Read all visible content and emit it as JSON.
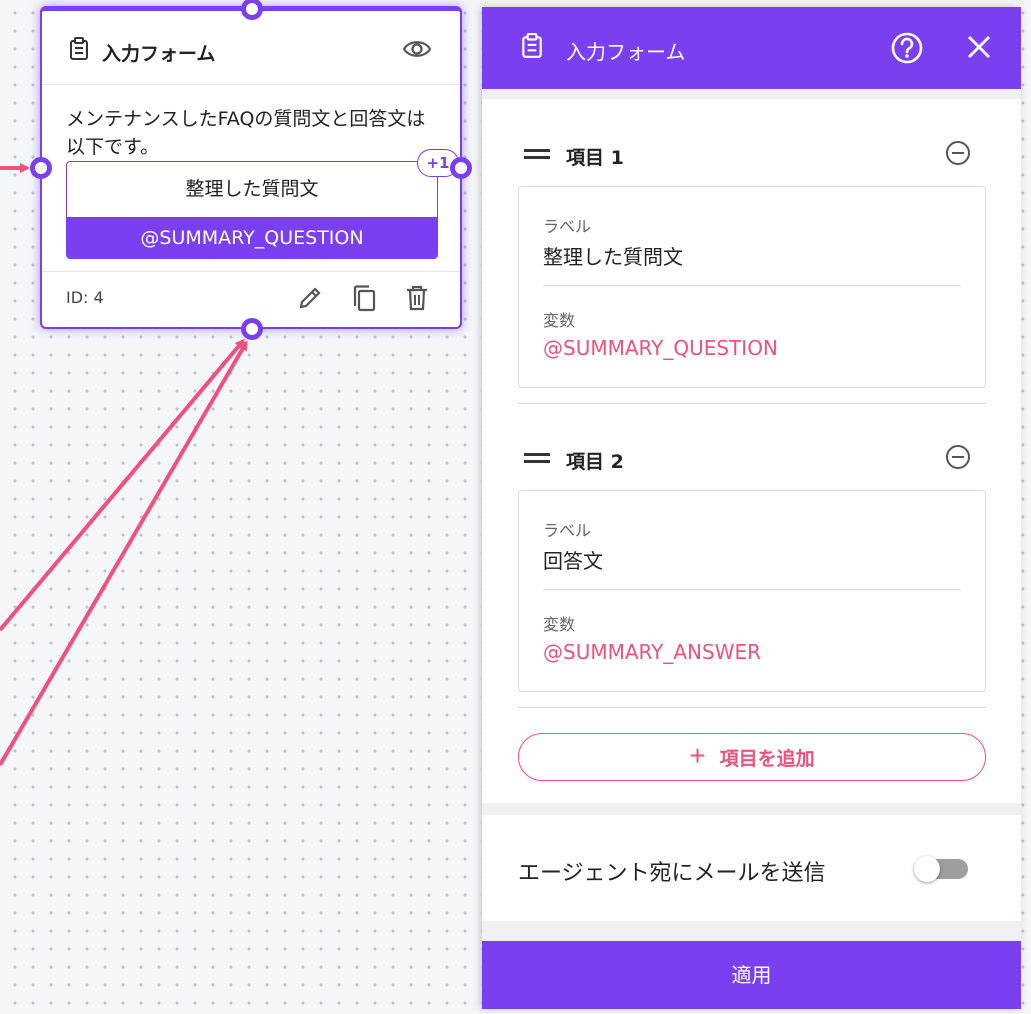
{
  "node": {
    "title": "入力フォーム",
    "description": "メンテナンスしたFAQの質問文と回答文は以下です。",
    "item_label": "整理した質問文",
    "item_variable": "@SUMMARY_QUESTION",
    "extra_count_badge": "+1",
    "id_label": "ID: 4",
    "icons": {
      "header": "clipboard-icon",
      "preview": "eye-icon",
      "edit": "pencil-icon",
      "copy": "copy-icon",
      "delete": "trash-icon"
    }
  },
  "panel": {
    "title": "入力フォーム",
    "icons": {
      "header": "clipboard-icon",
      "help": "help-circle-icon",
      "close": "close-icon"
    },
    "items": [
      {
        "title": "項目 1",
        "label_caption": "ラベル",
        "label_value": "整理した質問文",
        "variable_caption": "変数",
        "variable_value": "@SUMMARY_QUESTION"
      },
      {
        "title": "項目 2",
        "label_caption": "ラベル",
        "label_value": "回答文",
        "variable_caption": "変数",
        "variable_value": "@SUMMARY_ANSWER"
      }
    ],
    "add_item_icon": "+",
    "add_item_label": "項目を追加",
    "email_toggle": {
      "label": "エージェント宛にメールを送信",
      "enabled": false
    },
    "apply_label": "適用"
  },
  "colors": {
    "brand_purple": "#7b3ff2",
    "accent_pink": "#f0507a",
    "canvas_bg": "#f4f6f9"
  }
}
